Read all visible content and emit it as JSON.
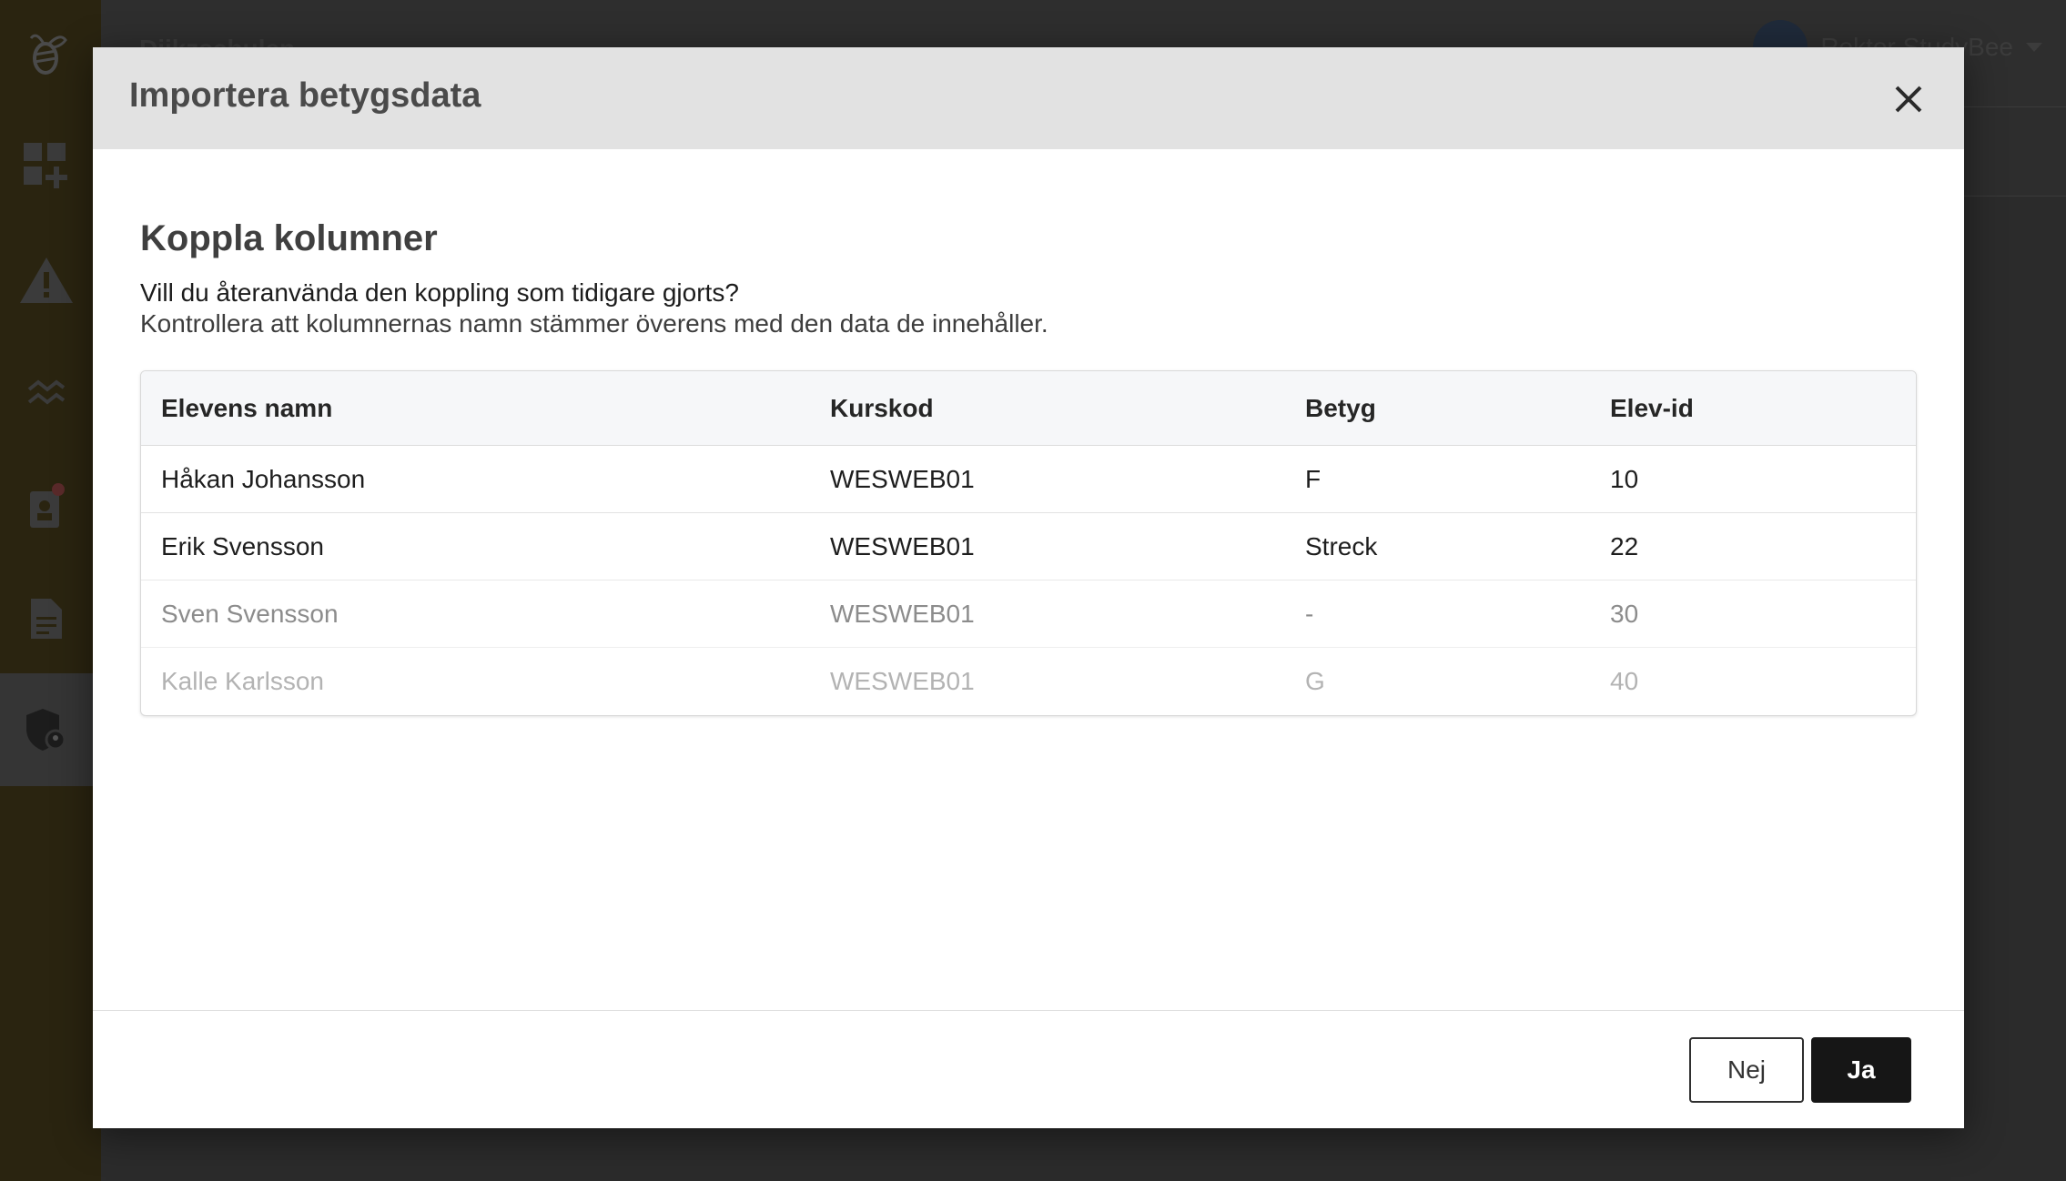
{
  "app": {
    "school_name": "Diikzschulen",
    "user_name": "Rektor StudyBee"
  },
  "sidebar": {
    "items": [
      {
        "icon": "bee-logo-icon"
      },
      {
        "icon": "dashboard-add-icon"
      },
      {
        "icon": "warning-icon"
      },
      {
        "icon": "trend-icon"
      },
      {
        "icon": "student-notification-icon"
      },
      {
        "icon": "document-icon"
      },
      {
        "icon": "shield-admin-icon",
        "active": true
      }
    ]
  },
  "modal": {
    "title": "Importera betygsdata",
    "section_title": "Koppla kolumner",
    "question": "Vill du återanvända den koppling som tidigare gjorts?",
    "hint": "Kontrollera att kolumnernas namn stämmer överens med den data de innehåller.",
    "table": {
      "headers": [
        "Elevens namn",
        "Kurskod",
        "Betyg",
        "Elev-id"
      ],
      "rows": [
        [
          "Håkan Johansson",
          "WESWEB01",
          "F",
          "10"
        ],
        [
          "Erik Svensson",
          "WESWEB01",
          "Streck",
          "22"
        ],
        [
          "Sven Svensson",
          "WESWEB01",
          "-",
          "30"
        ],
        [
          "Kalle Karlsson",
          "WESWEB01",
          "G",
          "40"
        ]
      ]
    },
    "buttons": {
      "no": "Nej",
      "yes": "Ja"
    }
  },
  "colors": {
    "sidebar_bg": "#2a2410",
    "modal_header_bg": "#e2e2e2",
    "primary_button": "#161616"
  }
}
